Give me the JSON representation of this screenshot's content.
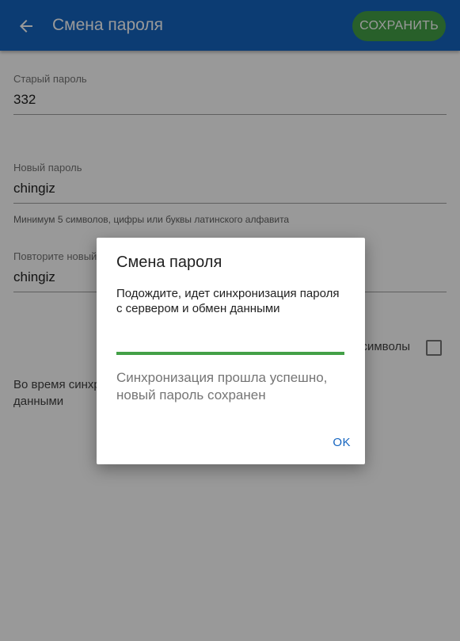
{
  "appbar": {
    "back_icon": "arrow-left-icon",
    "title": "Смена пароля",
    "save_label": "СОХРАНИТЬ"
  },
  "form": {
    "old_password": {
      "label": "Старый пароль",
      "value": "332"
    },
    "new_password": {
      "label": "Новый пароль",
      "value": "chingiz",
      "hint": "Минимум 5 символов, цифры или буквы латинского алфавита"
    },
    "repeat_password": {
      "label": "Повторите новый пароль",
      "value": "chingiz"
    },
    "show_symbols": {
      "label": "Показать символы",
      "checked": false
    },
    "sync_note": "Во время синхронизации с сервером будет происходить обмен данными"
  },
  "dialog": {
    "title": "Смена пароля",
    "message": "Подождите, идет синхронизация пароля с сервером и обмен данными",
    "progress": 1.0,
    "status": "Синхронизация прошла успешно, новый пароль сохранен",
    "ok_label": "OK"
  },
  "colors": {
    "primary": "#1565c0",
    "accent": "#43a047",
    "scrim": "rgba(0,0,0,0.40)"
  }
}
